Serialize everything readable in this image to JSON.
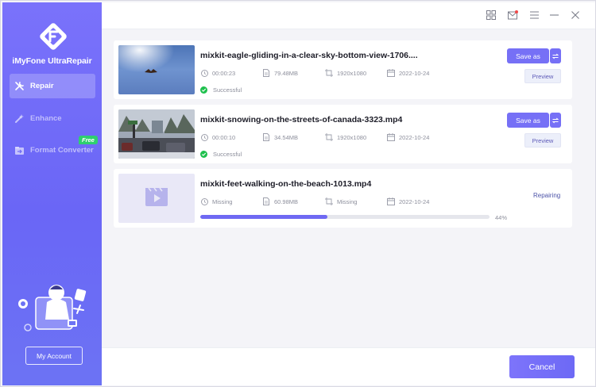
{
  "app": {
    "name": "iMyFone UltraRepair"
  },
  "sidebar": {
    "items": [
      {
        "label": "Repair",
        "icon": "repair-tools-icon",
        "active": true
      },
      {
        "label": "Enhance",
        "icon": "magic-wand-icon",
        "active": false
      },
      {
        "label": "Format Converter",
        "icon": "converter-icon",
        "active": false,
        "badge": "Free"
      }
    ],
    "account_button": "My Account"
  },
  "titlebar": {
    "icons": [
      "grid-icon",
      "mail-icon",
      "menu-icon",
      "minimize-icon",
      "close-icon"
    ]
  },
  "files": [
    {
      "name": "mixkit-eagle-gliding-in-a-clear-sky-bottom-view-1706....",
      "duration": "00:00:23",
      "size": "79.48MB",
      "resolution": "1920x1080",
      "date": "2022-10-24",
      "status": "Successful",
      "save_label": "Save as",
      "preview_label": "Preview"
    },
    {
      "name": "mixkit-snowing-on-the-streets-of-canada-3323.mp4",
      "duration": "00:00:10",
      "size": "34.54MB",
      "resolution": "1920x1080",
      "date": "2022-10-24",
      "status": "Successful",
      "save_label": "Save as",
      "preview_label": "Preview"
    },
    {
      "name": "mixkit-feet-walking-on-the-beach-1013.mp4",
      "duration": "Missing",
      "size": "60.98MB",
      "resolution": "Missing",
      "date": "2022-10-24",
      "state": "Repairing",
      "progress": 0.44,
      "progress_label": "44%"
    }
  ],
  "footer": {
    "cancel_label": "Cancel"
  },
  "colors": {
    "accent": "#7670f6",
    "success": "#1ec04d",
    "free_badge": "#2fcf6f"
  }
}
